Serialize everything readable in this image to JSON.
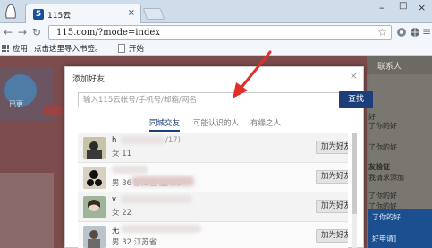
{
  "browser": {
    "tab_title": "115云",
    "tab_favicon_text": "5",
    "url": "115.com/?mode=index",
    "bookmarks": {
      "apps_label": "应用",
      "import_label": "点击这里导入书签。",
      "start_label": "开始"
    }
  },
  "background_page": {
    "right_panel_header": "联系人",
    "right_texts": [
      "已更",
      "好",
      "了你的好",
      "了你的好",
      "友验证",
      "我请求添加",
      "了你的好",
      "了你的好",
      "了你的好",
      "好申请]"
    ]
  },
  "modal": {
    "title": "添加好友",
    "close": "×",
    "search_placeholder": "输入115云帐号/手机号/邮箱/网名",
    "search_button": "查找",
    "tabs": [
      "同城交友",
      "可能认识的人",
      "有缘之人"
    ],
    "active_tab": 0,
    "users": [
      {
        "name": "h",
        "suffix": "/17)",
        "info": "女  11",
        "add_label": "加为好友"
      },
      {
        "name": "",
        "suffix": "",
        "info": "男  36  浙江省  温州市",
        "add_label": "加为好友"
      },
      {
        "name": "v",
        "suffix": "",
        "info": "女  22",
        "add_label": "加为好友"
      },
      {
        "name": "无",
        "suffix": "",
        "info": "男  32  江苏省",
        "add_label": "加为好友"
      }
    ]
  },
  "colors": {
    "accent": "#1c3f7a",
    "annotation_arrow": "#e0302a"
  }
}
